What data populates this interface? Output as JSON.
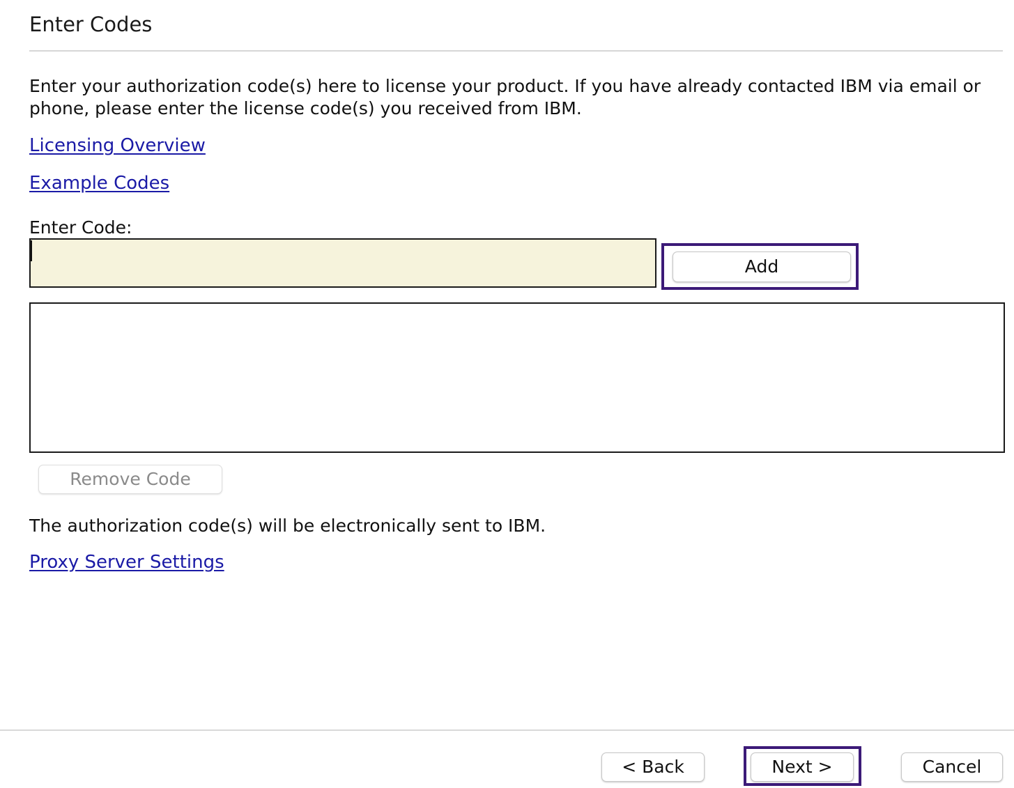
{
  "header": {
    "title": "Enter Codes"
  },
  "intro": {
    "text": "Enter your authorization code(s) here to license your product. If you have already contacted IBM via email or phone, please enter the license code(s) you received from IBM."
  },
  "links": {
    "licensing_overview": "Licensing Overview",
    "example_codes": "Example Codes",
    "proxy_server_settings": "Proxy Server Settings"
  },
  "code_entry": {
    "label": "Enter Code:",
    "value": "",
    "add_label": "Add",
    "codes": [],
    "remove_label": "Remove Code"
  },
  "note": {
    "text": "The authorization code(s) will be electronically sent to IBM."
  },
  "footer": {
    "back_label": "< Back",
    "next_label": "Next >",
    "cancel_label": "Cancel"
  },
  "colors": {
    "link": "#1a1aa6",
    "input_background": "#f6f3dc",
    "focus_ring": "#3c1a78",
    "disabled_text": "#8a8a8a"
  }
}
